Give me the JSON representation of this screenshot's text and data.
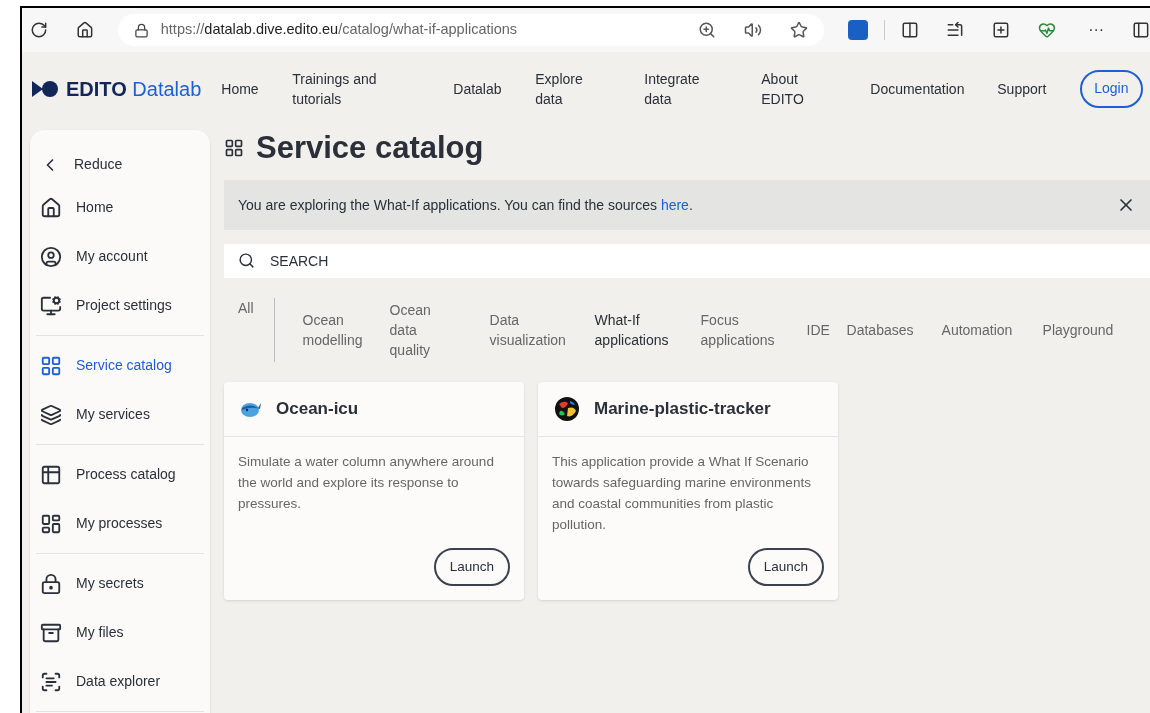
{
  "browser": {
    "url": {
      "scheme": "https://",
      "host": "datalab.dive.edito.eu",
      "path": "/catalog/what-if-applications"
    },
    "more": "···"
  },
  "header": {
    "logo": {
      "brand": "EDITO",
      "product": "Datalab"
    },
    "nav": [
      {
        "label": "Home"
      },
      {
        "label": "Trainings and tutorials"
      },
      {
        "label": "Datalab"
      },
      {
        "label": "Explore data"
      },
      {
        "label": "Integrate data"
      },
      {
        "label": "About EDITO"
      },
      {
        "label": "Documentation"
      },
      {
        "label": "Support"
      }
    ],
    "login": "Login"
  },
  "sidebar": {
    "collapse": "Reduce",
    "groups": [
      {
        "items": [
          {
            "label": "Home",
            "selected": false
          },
          {
            "label": "My account",
            "selected": false
          },
          {
            "label": "Project settings",
            "selected": false
          }
        ]
      },
      {
        "items": [
          {
            "label": "Service catalog",
            "selected": true
          },
          {
            "label": "My services",
            "selected": false
          }
        ]
      },
      {
        "items": [
          {
            "label": "Process catalog",
            "selected": false
          },
          {
            "label": "My processes",
            "selected": false
          }
        ]
      },
      {
        "items": [
          {
            "label": "My secrets",
            "selected": false
          },
          {
            "label": "My files",
            "selected": false
          },
          {
            "label": "Data explorer",
            "selected": false
          }
        ]
      }
    ]
  },
  "main": {
    "title": "Service catalog",
    "banner": {
      "text": "You are exploring the What-If applications. You can find the sources",
      "link": "here",
      "end": "."
    },
    "search": {
      "placeholder": "SEARCH"
    },
    "categories": [
      {
        "label": "All",
        "selected": false
      },
      {
        "label": "Ocean modelling",
        "selected": false
      },
      {
        "label": "Ocean data quality",
        "selected": false
      },
      {
        "label": "Data visualization",
        "selected": false
      },
      {
        "label": "What-If applications",
        "selected": true
      },
      {
        "label": "Focus applications",
        "selected": false
      },
      {
        "label": "IDE",
        "selected": false
      },
      {
        "label": "Databases",
        "selected": false
      },
      {
        "label": "Automation",
        "selected": false
      },
      {
        "label": "Playground",
        "selected": false
      }
    ],
    "cards": [
      {
        "title": "Ocean-icu",
        "description": "Simulate a water column anywhere around the world and explore its response to pressures.",
        "action": "Launch"
      },
      {
        "title": "Marine-plastic-tracker",
        "description": "This application provide a What If Scenario towards safeguarding marine environments and coastal communities from plastic pollution.",
        "action": "Launch"
      }
    ]
  }
}
